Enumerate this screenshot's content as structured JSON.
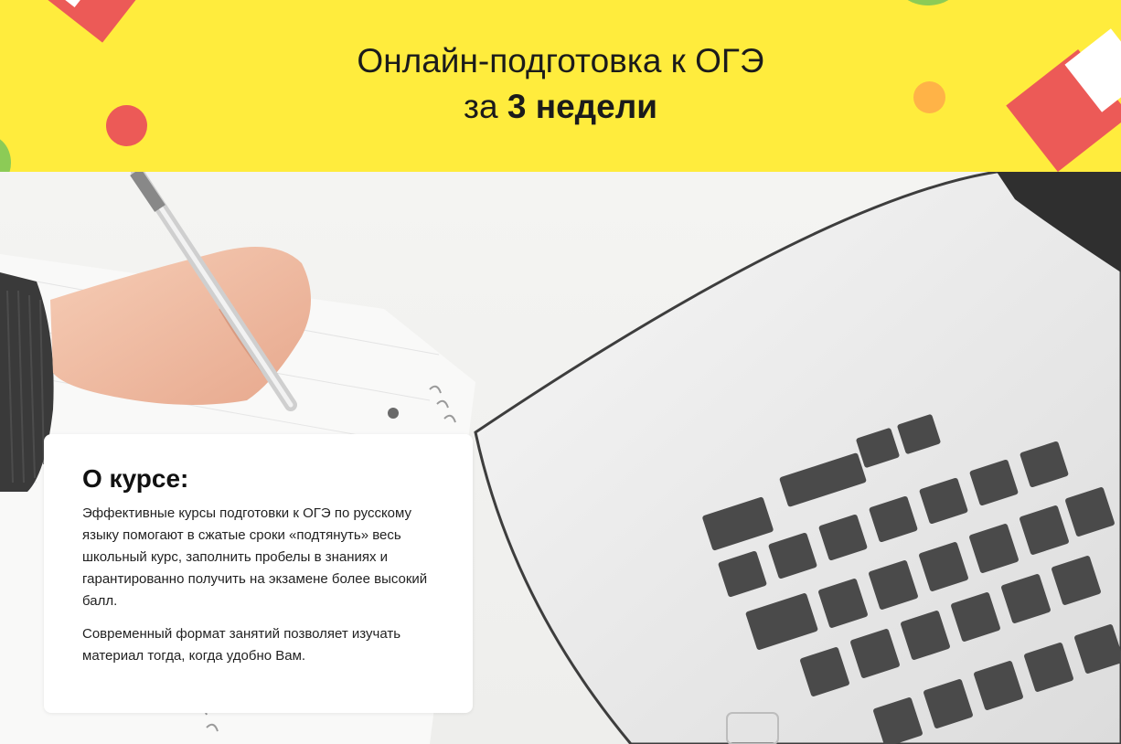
{
  "header": {
    "title_line1": "Онлайн-подготовка к ОГЭ",
    "title_line2_prefix": "за",
    "title_line2_bold": "3 недели"
  },
  "about": {
    "heading": "О курсе:",
    "paragraph1": "Эффективные курсы подготовки к ОГЭ по русскому языку помогают в сжатые сроки «подтянуть» весь школьный курс, заполнить пробелы в знаниях и гарантированно получить на экзамене более высокий балл.",
    "paragraph2": "Современный формат занятий позволяет изучать материал тогда, когда удобно Вам."
  },
  "colors": {
    "banner": "#ffec3d",
    "accent_red": "#ec5a57",
    "accent_green": "#8ccb56",
    "accent_orange": "#ffb347"
  }
}
